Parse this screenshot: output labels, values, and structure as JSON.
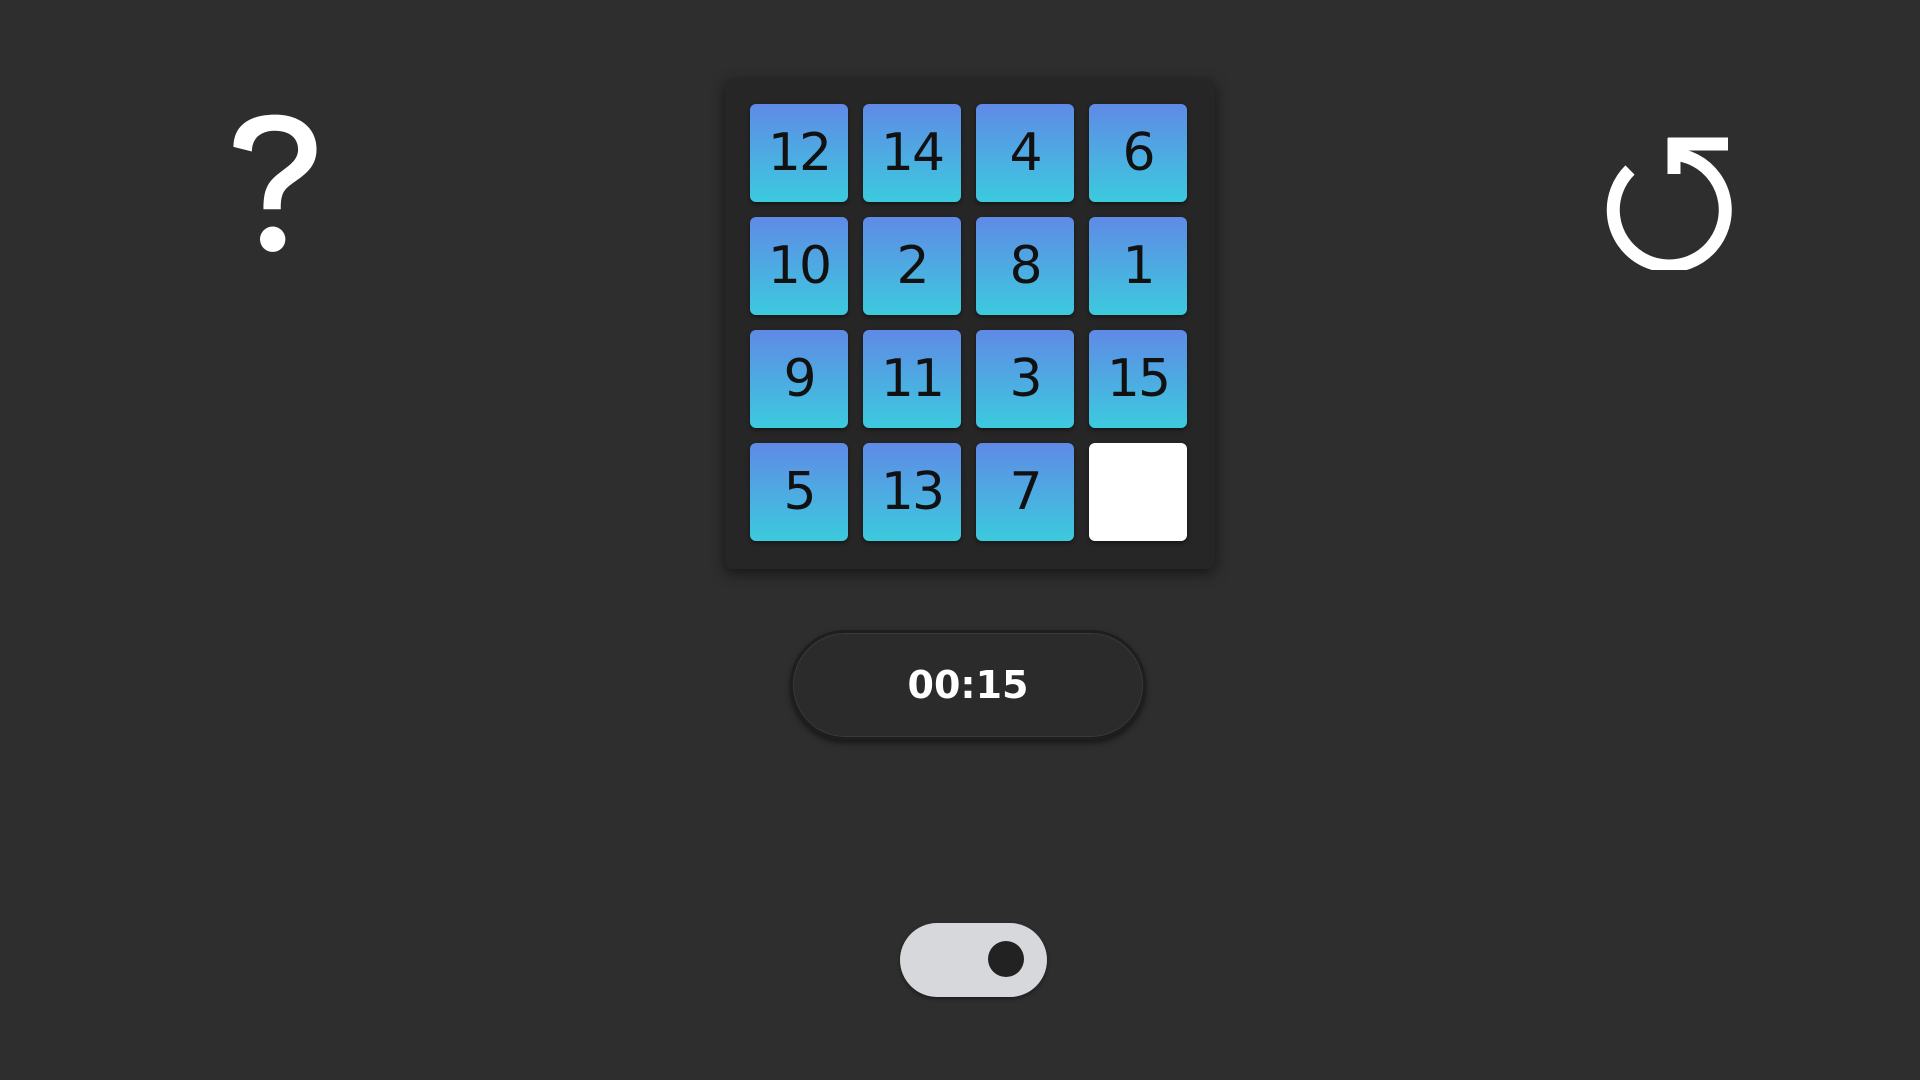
{
  "icons": {
    "help": "question-mark-icon",
    "restart": "restart-icon"
  },
  "board": {
    "rows": [
      [
        "12",
        "14",
        "4",
        "6"
      ],
      [
        "10",
        "2",
        "8",
        "1"
      ],
      [
        "9",
        "11",
        "3",
        "15"
      ],
      [
        "5",
        "13",
        "7",
        ""
      ]
    ]
  },
  "timer": {
    "value": "00:15"
  },
  "toggle": {
    "on": true
  },
  "colors": {
    "background": "#2e2e2e",
    "tile_top": "#5f8ae6",
    "tile_bottom": "#3ccade",
    "empty_tile": "#ffffff",
    "toggle_track": "#d6d8db"
  }
}
